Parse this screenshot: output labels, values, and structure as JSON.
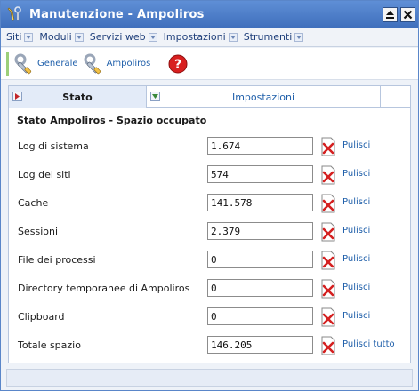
{
  "window": {
    "title": "Manutenzione - Ampoliros"
  },
  "menu": {
    "items": [
      {
        "label": "Siti"
      },
      {
        "label": "Moduli"
      },
      {
        "label": "Servizi web"
      },
      {
        "label": "Impostazioni"
      },
      {
        "label": "Strumenti"
      }
    ]
  },
  "toolbar": {
    "generale_label": "Generale",
    "ampoliros_label": "Ampoliros",
    "help_icon": "help-icon"
  },
  "tabs": {
    "stato_label": "Stato",
    "impostazioni_label": "Impostazioni"
  },
  "section": {
    "title": "Stato Ampoliros - Spazio occupato"
  },
  "rows": [
    {
      "label": "Log di sistema",
      "value": "1.674",
      "action": "Pulisci"
    },
    {
      "label": "Log dei siti",
      "value": "574",
      "action": "Pulisci"
    },
    {
      "label": "Cache",
      "value": "141.578",
      "action": "Pulisci"
    },
    {
      "label": "Sessioni",
      "value": "2.379",
      "action": "Pulisci"
    },
    {
      "label": "File dei processi",
      "value": "0",
      "action": "Pulisci"
    },
    {
      "label": "Directory temporanee di Ampoliros",
      "value": "0",
      "action": "Pulisci"
    },
    {
      "label": "Clipboard",
      "value": "0",
      "action": "Pulisci"
    },
    {
      "label": "Totale spazio",
      "value": "146.205",
      "action": "Pulisci tutto"
    }
  ],
  "colors": {
    "titlebar": "#4a7cc7",
    "link": "#1f5faa",
    "delete": "#d42020"
  }
}
